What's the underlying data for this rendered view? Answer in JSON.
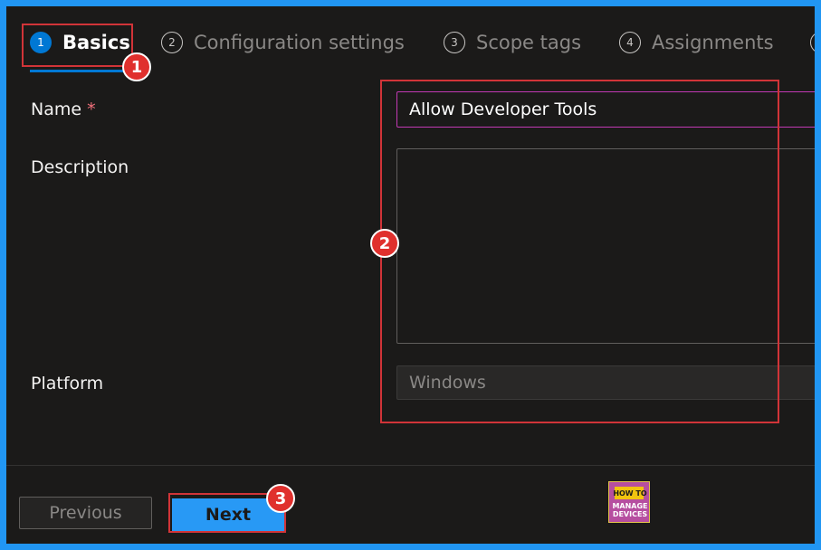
{
  "tabs": [
    {
      "num": "1",
      "label": "Basics",
      "active": true
    },
    {
      "num": "2",
      "label": "Configuration settings",
      "active": false
    },
    {
      "num": "3",
      "label": "Scope tags",
      "active": false
    },
    {
      "num": "4",
      "label": "Assignments",
      "active": false
    }
  ],
  "form": {
    "name_label": "Name",
    "required_mark": "*",
    "name_value": "Allow Developer Tools",
    "description_label": "Description",
    "description_value": "",
    "platform_label": "Platform",
    "platform_value": "Windows"
  },
  "footer": {
    "previous_label": "Previous",
    "next_label": "Next"
  },
  "annotations": [
    "1",
    "2",
    "3"
  ],
  "logo": {
    "line1": "HOW TO",
    "line2": "MANAGE",
    "line3": "DEVICES"
  },
  "colors": {
    "accent": "#0078d4",
    "highlight": "#d13438",
    "next_button": "#2899f5",
    "name_border": "#c239b3",
    "frame_border": "#2196f3"
  }
}
